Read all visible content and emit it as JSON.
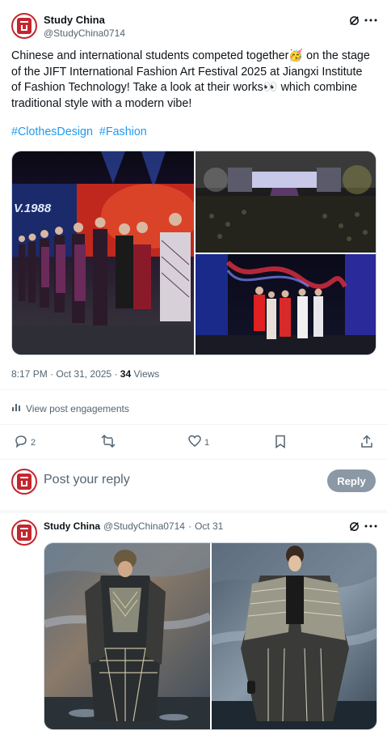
{
  "post": {
    "author_name": "Study China",
    "author_handle": "@StudyChina0714",
    "text": "Chinese and international students competed together🥳 on the stage of the JIFT International Fashion Art Festival 2025 at Jiangxi Institute of Fashion Technology! Take a look at their works👀 which combine traditional style with a modern vibe!",
    "hashtags": [
      "#ClothesDesign",
      "#Fashion"
    ],
    "media": {
      "main_backdrop_text": "V.1988"
    },
    "time": "8:17 PM",
    "date": "Oct 31, 2025",
    "views_count": "34",
    "views_label": "Views",
    "engagements_label": "View post engagements",
    "separator": "·",
    "actions": {
      "reply_count": "2",
      "like_count": "1"
    }
  },
  "reply_composer": {
    "placeholder": "Post your reply",
    "button_label": "Reply"
  },
  "reply_post": {
    "author_name": "Study China",
    "author_handle": "@StudyChina0714",
    "date": "Oct 31",
    "separator": "·"
  },
  "icons": [
    "grok-icon",
    "more-icon",
    "analytics-icon",
    "reply-icon",
    "repost-icon",
    "like-icon",
    "bookmark-icon",
    "share-icon"
  ],
  "colors": {
    "hashtag": "#1d9bf0",
    "reply_button": "#8b98a5",
    "avatar_red": "#c4262e"
  }
}
